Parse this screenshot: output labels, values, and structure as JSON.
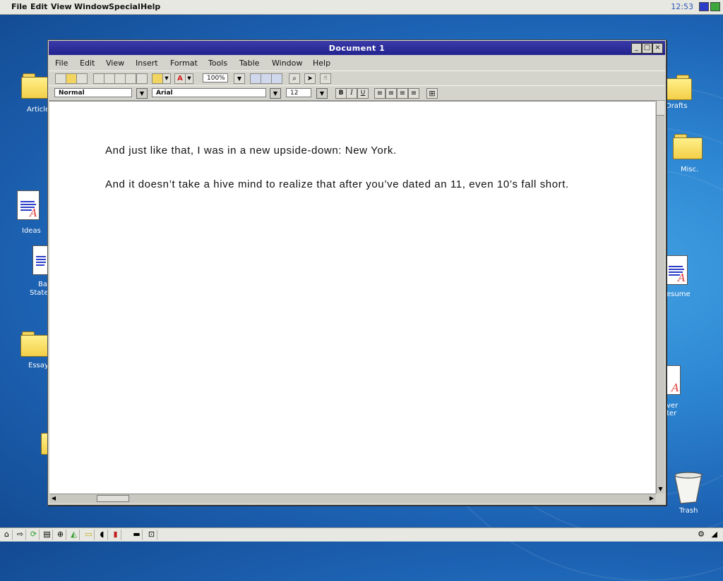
{
  "menubar": {
    "items": [
      "File",
      "Edit",
      "View",
      "Window",
      "Special",
      "Help"
    ],
    "clock": "12:53"
  },
  "desktop": {
    "left_icons": [
      {
        "label": "Article"
      },
      {
        "label": "Ideas"
      },
      {
        "label_line1": "Ba",
        "label_line2": "State"
      },
      {
        "label": "Essays"
      }
    ],
    "right_icons": [
      {
        "label": "Drafts"
      },
      {
        "label": "Misc."
      },
      {
        "label": "esume"
      },
      {
        "label_line1": "ver",
        "label_line2": "ter"
      },
      {
        "label": "Trash"
      }
    ]
  },
  "window": {
    "title": "Document 1",
    "controls": {
      "minimize": "_",
      "maximize": "□",
      "close": "×"
    },
    "menu": [
      "File",
      "Edit",
      "View",
      "Insert",
      "Format",
      "Tools",
      "Table",
      "Window",
      "Help"
    ],
    "zoom": "100%",
    "style": "Normal",
    "font": "Arial",
    "size": "12",
    "format_buttons": {
      "bold": "B",
      "italic": "I",
      "underline": "U"
    }
  },
  "document": {
    "paragraphs": [
      "And just like that, I was in a new upside-down: New York.",
      "And it doesn’t take a hive mind to realize that after you’ve dated an 11, even 10’s fall short."
    ]
  },
  "colors": {
    "desktop": "#2d86d2",
    "titlebar": "#2a2a9c",
    "accent_blue": "#2c3ec8"
  }
}
